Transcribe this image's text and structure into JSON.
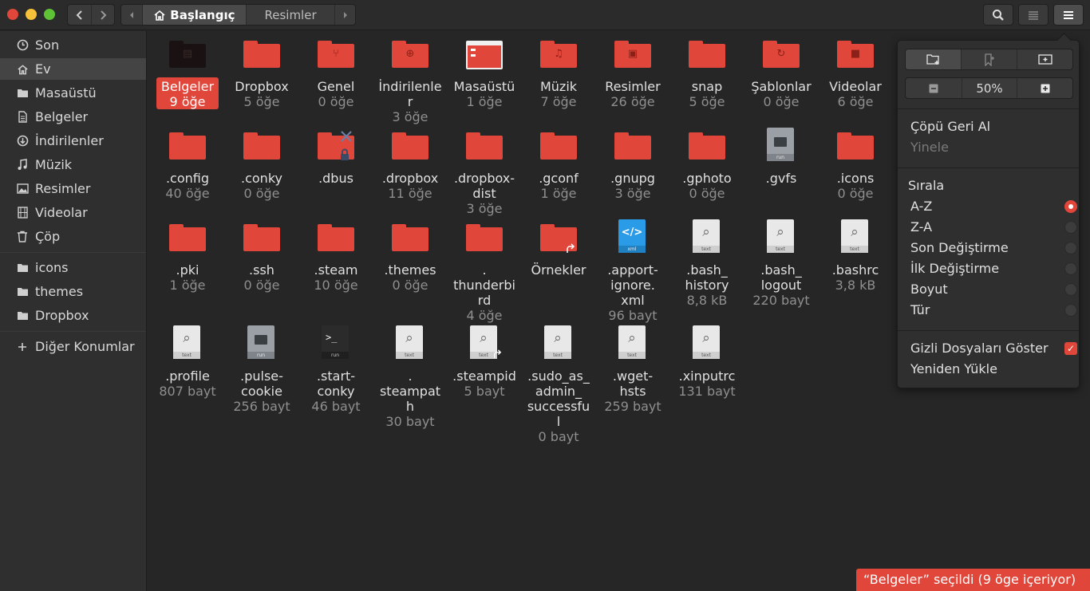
{
  "colors": {
    "accent": "#e0463a",
    "close": "#e0463a",
    "minimize": "#f5c23a",
    "maximize": "#5fc236",
    "background": "#262626",
    "sidebar": "#2f2f2f"
  },
  "header": {
    "back_icon": "chevron-left-icon",
    "forward_icon": "chevron-right-icon",
    "breadcrumb": {
      "home_label": "Başlangıç",
      "child_label": "Resimler"
    },
    "search_icon": "search-icon",
    "view_icon": "list-view-icon",
    "menu_icon": "hamburger-menu-icon"
  },
  "sidebar": {
    "items": [
      {
        "label": "Son",
        "icon": "clock-icon"
      },
      {
        "label": "Ev",
        "icon": "home-icon"
      },
      {
        "label": "Masaüstü",
        "icon": "folder-icon"
      },
      {
        "label": "Belgeler",
        "icon": "document-icon"
      },
      {
        "label": "İndirilenler",
        "icon": "download-icon"
      },
      {
        "label": "Müzik",
        "icon": "music-icon"
      },
      {
        "label": "Resimler",
        "icon": "image-icon"
      },
      {
        "label": "Videolar",
        "icon": "film-icon"
      },
      {
        "label": "Çöp",
        "icon": "trash-icon"
      }
    ],
    "bookmarks": [
      {
        "label": "icons",
        "icon": "folder-icon"
      },
      {
        "label": "themes",
        "icon": "folder-icon"
      },
      {
        "label": "Dropbox",
        "icon": "folder-icon"
      }
    ],
    "other_locations": {
      "label": "Diğer Konumlar",
      "icon": "plus-icon"
    }
  },
  "files": [
    {
      "name": "Belgeler",
      "info": "9 öğe",
      "kind": "folder-dark"
    },
    {
      "name": "Dropbox",
      "info": "5 öğe",
      "kind": "folder"
    },
    {
      "name": "Genel",
      "info": "0 öğe",
      "kind": "folder-share"
    },
    {
      "name": "İndirilenler",
      "info": "3 öğe",
      "kind": "folder-download"
    },
    {
      "name": "Masaüstü",
      "info": "1 öğe",
      "kind": "folder-desktop"
    },
    {
      "name": "Müzik",
      "info": "7 öğe",
      "kind": "folder-music"
    },
    {
      "name": "Resimler",
      "info": "26 öğe",
      "kind": "folder-image"
    },
    {
      "name": "snap",
      "info": "5 öğe",
      "kind": "folder"
    },
    {
      "name": "Şablonlar",
      "info": "0 öğe",
      "kind": "folder-template"
    },
    {
      "name": "Videolar",
      "info": "6 öğe",
      "kind": "folder-video"
    },
    {
      "name": ".config",
      "info": "40 öğe",
      "kind": "folder"
    },
    {
      "name": ".conky",
      "info": "0 öğe",
      "kind": "folder"
    },
    {
      "name": ".dbus",
      "info": "",
      "kind": "folder-locked"
    },
    {
      "name": ".dropbox",
      "info": "11 öğe",
      "kind": "folder"
    },
    {
      "name": ".dropbox-dist",
      "info": "3 öğe",
      "kind": "folder"
    },
    {
      "name": ".gconf",
      "info": "1 öğe",
      "kind": "folder"
    },
    {
      "name": ".gnupg",
      "info": "3 öğe",
      "kind": "folder"
    },
    {
      "name": ".gphoto",
      "info": "0 öğe",
      "kind": "folder"
    },
    {
      "name": ".gvfs",
      "info": "",
      "kind": "exec"
    },
    {
      "name": ".icons",
      "info": "0 öğe",
      "kind": "folder"
    },
    {
      "name": ".pki",
      "info": "1 öğe",
      "kind": "folder"
    },
    {
      "name": ".ssh",
      "info": "0 öğe",
      "kind": "folder"
    },
    {
      "name": ".steam",
      "info": "10 öğe",
      "kind": "folder"
    },
    {
      "name": ".themes",
      "info": "0 öğe",
      "kind": "folder"
    },
    {
      "name": ".thunderbird",
      "info": "4 öğe",
      "kind": "folder"
    },
    {
      "name": "Örnekler",
      "info": "",
      "kind": "folder-link"
    },
    {
      "name": ".apport-ignore.xml",
      "info": "96 bayt",
      "kind": "xml"
    },
    {
      "name": ".bash_history",
      "info": "8,8 kB",
      "kind": "text"
    },
    {
      "name": ".bash_logout",
      "info": "220 bayt",
      "kind": "text"
    },
    {
      "name": ".bashrc",
      "info": "3,8 kB",
      "kind": "text"
    },
    {
      "name": ".profile",
      "info": "807 bayt",
      "kind": "text"
    },
    {
      "name": ".pulse-cookie",
      "info": "256 bayt",
      "kind": "exec"
    },
    {
      "name": ".start-conky",
      "info": "46 bayt",
      "kind": "term"
    },
    {
      "name": ".steampath",
      "info": "30 bayt",
      "kind": "text"
    },
    {
      "name": ".steampid",
      "info": "5 bayt",
      "kind": "text-link"
    },
    {
      "name": ".sudo_as_admin_successful",
      "info": "0 bayt",
      "kind": "text"
    },
    {
      "name": ".wget-hsts",
      "info": "259 bayt",
      "kind": "text"
    },
    {
      "name": ".xinputrc",
      "info": "131 bayt",
      "kind": "text"
    }
  ],
  "file_label_lines": {
    "indirilenler": [
      "İndirilenle",
      "r"
    ],
    "dropbox_dist": [
      ".dropbox-",
      "dist"
    ],
    "thunderbird": [
      ".",
      "thunderbi",
      "rd"
    ],
    "apport": [
      ".apport-",
      "ignore.",
      "xml"
    ],
    "bash_history": [
      ".bash_",
      "history"
    ],
    "bash_logout": [
      ".bash_",
      "logout"
    ],
    "pulse": [
      ".pulse-",
      "cookie"
    ],
    "start_conky": [
      ".start-",
      "conky"
    ],
    "steampath": [
      ".",
      "steampat",
      "h"
    ],
    "sudo": [
      ".sudo_as_",
      "admin_",
      "successfu",
      "l"
    ],
    "wget": [
      ".wget-",
      "hsts"
    ]
  },
  "icon_bands": {
    "text": "text",
    "run": "run",
    "xml": "xml"
  },
  "popover": {
    "new_folder_icon": "new-folder-icon",
    "bookmark_icon": "bookmark-add-icon",
    "new_tab_icon": "new-tab-icon",
    "zoom_out_icon": "zoom-out-icon",
    "zoom_level": "50%",
    "zoom_in_icon": "zoom-in-icon",
    "undo_trash": "Çöpü Geri Al",
    "redo": "Yinele",
    "sort_heading": "Sırala",
    "sort_options": [
      {
        "label": "A-Z",
        "selected": true
      },
      {
        "label": "Z-A",
        "selected": false
      },
      {
        "label": "Son Değiştirme",
        "selected": false
      },
      {
        "label": "İlk Değiştirme",
        "selected": false
      },
      {
        "label": "Boyut",
        "selected": false
      },
      {
        "label": "Tür",
        "selected": false
      }
    ],
    "show_hidden": {
      "label": "Gizli Dosyaları Göster",
      "checked": true
    },
    "reload": "Yeniden Yükle"
  },
  "status": {
    "text": "“Belgeler” seçildi (9 öge içeriyor)"
  }
}
